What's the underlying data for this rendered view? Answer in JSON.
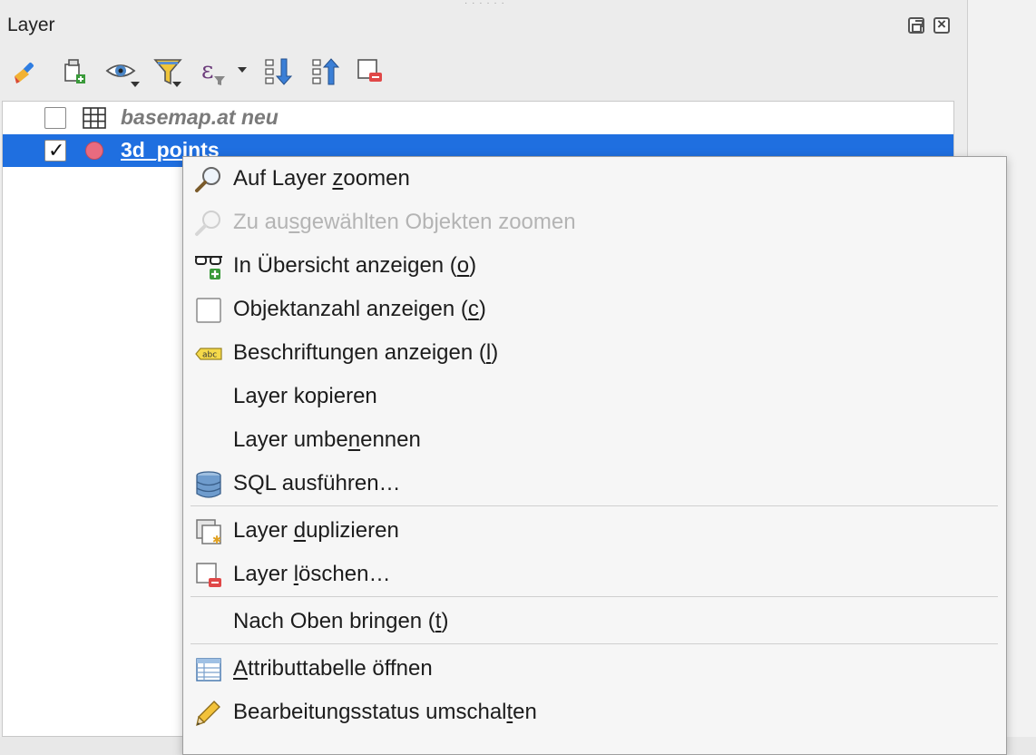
{
  "panel": {
    "title": "Layer",
    "toolbar": [
      {
        "icon": "style-brush-icon"
      },
      {
        "icon": "add-group-icon"
      },
      {
        "icon": "eye-visibility-icon"
      },
      {
        "icon": "filter-icon"
      },
      {
        "icon": "expression-filter-icon"
      },
      {
        "icon": "expand-all-icon"
      },
      {
        "icon": "collapse-all-icon"
      },
      {
        "icon": "remove-layer-icon"
      }
    ]
  },
  "layers": [
    {
      "name": "basemap.at neu",
      "checked": false,
      "icon": "raster-grid-icon"
    },
    {
      "name": "3d_points",
      "checked": true,
      "icon": "point-layer-icon",
      "selected": true
    }
  ],
  "context_menu": {
    "items": [
      {
        "pre": "Auf Layer ",
        "u": "z",
        "post": "oomen",
        "icon": "zoom-magnifier-icon",
        "enabled": true
      },
      {
        "pre": "Zu au",
        "u": "s",
        "post": "gewählten Objekten zoomen",
        "icon": "zoom-selected-icon",
        "enabled": false
      },
      {
        "pre": "In Übersicht anzeigen (",
        "u": "o",
        "post": ")",
        "icon": "glasses-overview-icon",
        "enabled": true
      },
      {
        "pre": "Objektanzahl anzeigen (",
        "u": "c",
        "post": ")",
        "icon": "checkbox-icon",
        "enabled": true
      },
      {
        "pre": "Beschriftungen anzeigen (",
        "u": "l",
        "post": ")",
        "icon": "label-abc-icon",
        "icon_text": "abc",
        "enabled": true
      },
      {
        "pre": "Layer kopieren",
        "u": "",
        "post": "",
        "icon": "",
        "enabled": true
      },
      {
        "pre": "Layer umbe",
        "u": "n",
        "post": "ennen",
        "icon": "",
        "enabled": true
      },
      {
        "pre": "SQL ausführen…",
        "u": "",
        "post": "",
        "icon": "database-icon",
        "enabled": true
      },
      {
        "pre": "Layer ",
        "u": "d",
        "post": "uplizieren",
        "icon": "duplicate-layer-icon",
        "enabled": true
      },
      {
        "pre": "Layer ",
        "u": "l",
        "post": "öschen…",
        "icon": "remove-layer-icon",
        "enabled": true
      },
      {
        "pre": "Nach Oben bringen (",
        "u": "t",
        "post": ")",
        "icon": "",
        "enabled": true
      },
      {
        "pre": "",
        "u": "A",
        "post": "ttributtabelle öffnen",
        "icon": "attribute-table-icon",
        "enabled": true
      },
      {
        "pre": "Bearbeitungsstatus umschal",
        "u": "t",
        "post": "en",
        "icon": "pencil-edit-icon",
        "enabled": true
      }
    ]
  },
  "colors": {
    "selection": "#1f6fe0",
    "point": "#e96b7f"
  }
}
